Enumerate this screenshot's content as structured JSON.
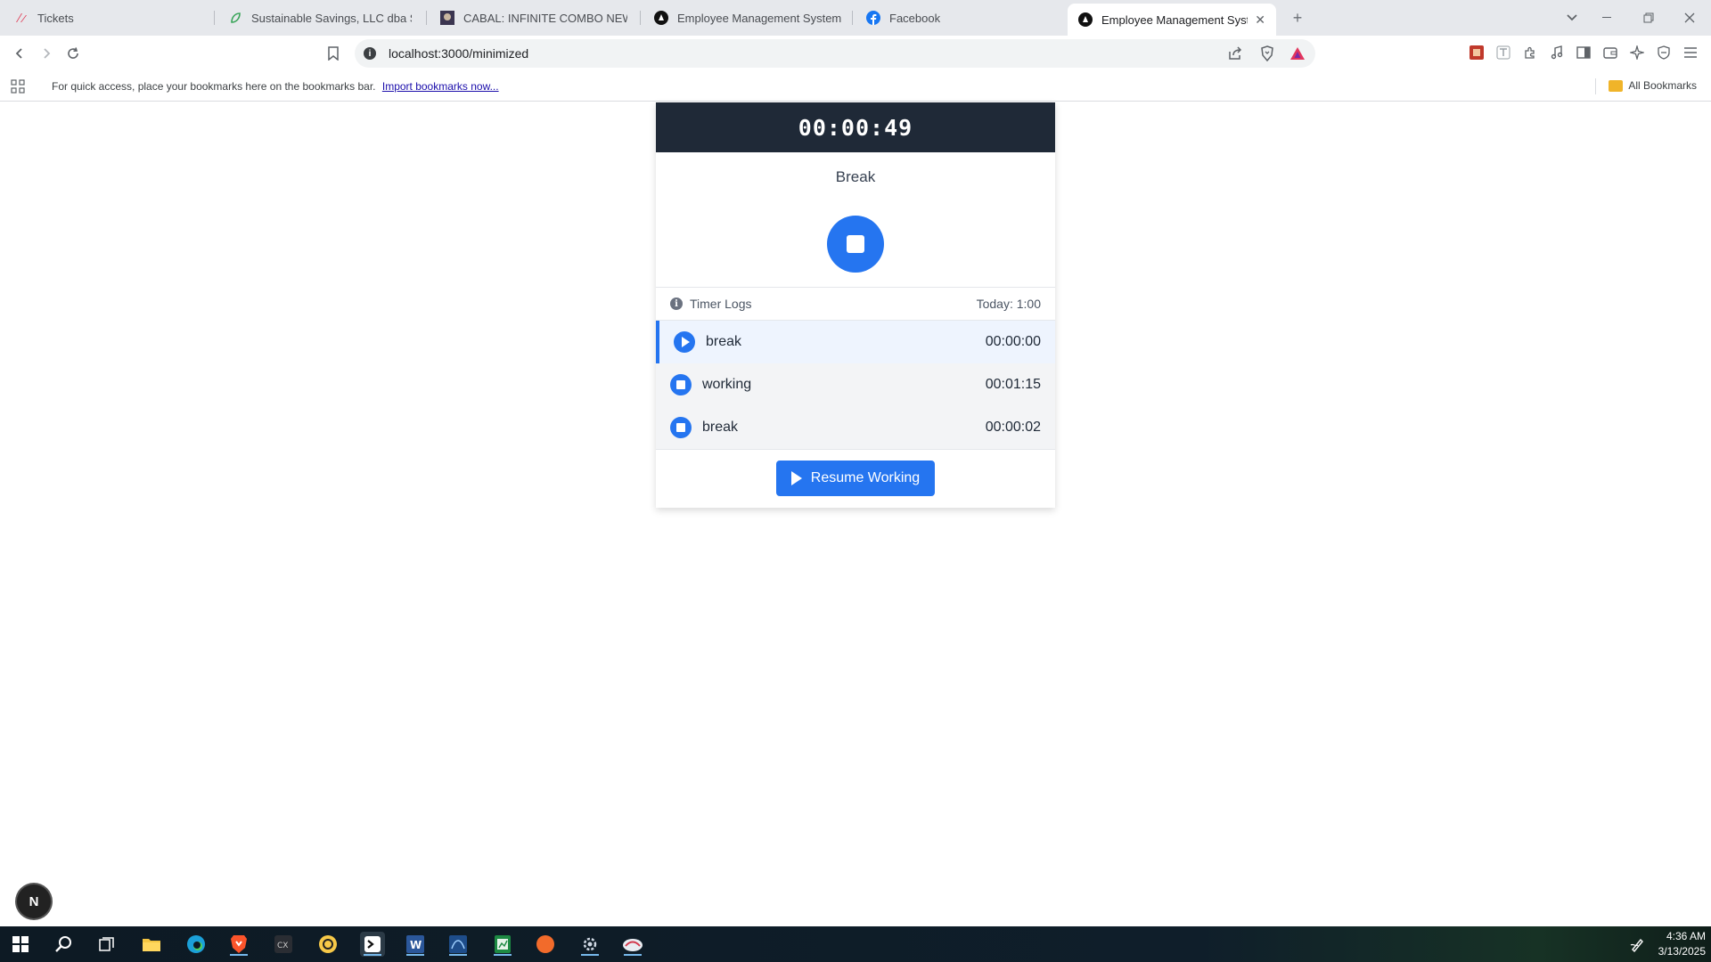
{
  "browser": {
    "tabs": [
      {
        "title": "Tickets",
        "icon": "zendesk-icon"
      },
      {
        "title": "Sustainable Savings, LLC dba Sustai",
        "icon": "leaf-icon"
      },
      {
        "title": "CABAL: INFINITE COMBO NEWS",
        "icon": "cabal-icon"
      },
      {
        "title": "Employee Management System",
        "icon": "nextjs-icon"
      },
      {
        "title": "Facebook",
        "icon": "facebook-icon"
      },
      {
        "title": "Employee Management System",
        "icon": "nextjs-icon",
        "active": true
      }
    ],
    "address": "localhost:3000/minimized",
    "bookmarks_message": "For quick access, place your bookmarks here on the bookmarks bar.",
    "import_link": "Import bookmarks now...",
    "all_bookmarks": "All Bookmarks"
  },
  "timer": {
    "elapsed": "00:00:49",
    "status": "Break",
    "logs_title": "Timer Logs",
    "today_total": "Today: 1:00",
    "logs": [
      {
        "label": "break",
        "duration": "00:00:00",
        "state": "active",
        "icon": "play-icon"
      },
      {
        "label": "working",
        "duration": "00:01:15",
        "state": "stopped",
        "icon": "stop-icon"
      },
      {
        "label": "break",
        "duration": "00:00:02",
        "state": "stopped",
        "icon": "stop-icon"
      }
    ],
    "resume_label": "Resume Working"
  },
  "next_badge": "N",
  "taskbar": {
    "time": "4:36 AM",
    "date": "3/13/2025"
  },
  "colors": {
    "accent": "#2575f0",
    "header_bg": "#1f2937"
  }
}
